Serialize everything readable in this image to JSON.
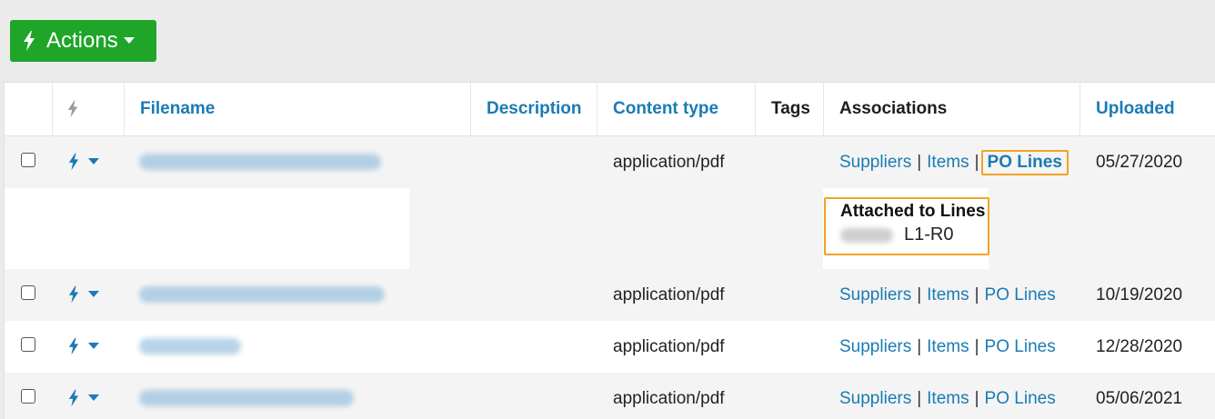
{
  "toolbar": {
    "actions_label": "Actions"
  },
  "table": {
    "headers": {
      "filename": "Filename",
      "description": "Description",
      "content_type": "Content type",
      "tags": "Tags",
      "associations": "Associations",
      "uploaded": "Uploaded"
    },
    "rows": [
      {
        "content_type": "application/pdf",
        "uploaded": "05/27/2020"
      },
      {
        "content_type": "application/pdf",
        "uploaded": "10/19/2020"
      },
      {
        "content_type": "application/pdf",
        "uploaded": "12/28/2020"
      },
      {
        "content_type": "application/pdf",
        "uploaded": "05/06/2021"
      }
    ],
    "assoc": {
      "suppliers": "Suppliers",
      "items": "Items",
      "po_lines": "PO Lines",
      "sep": "|"
    },
    "attached": {
      "title": "Attached to Lines",
      "line": "L1-R0"
    }
  },
  "colors": {
    "accent": "#1a7bb3",
    "button": "#1fa528",
    "highlight": "#f2a324"
  },
  "icons": {
    "actions": "lightning-icon",
    "dropdown": "caret-down-icon"
  }
}
